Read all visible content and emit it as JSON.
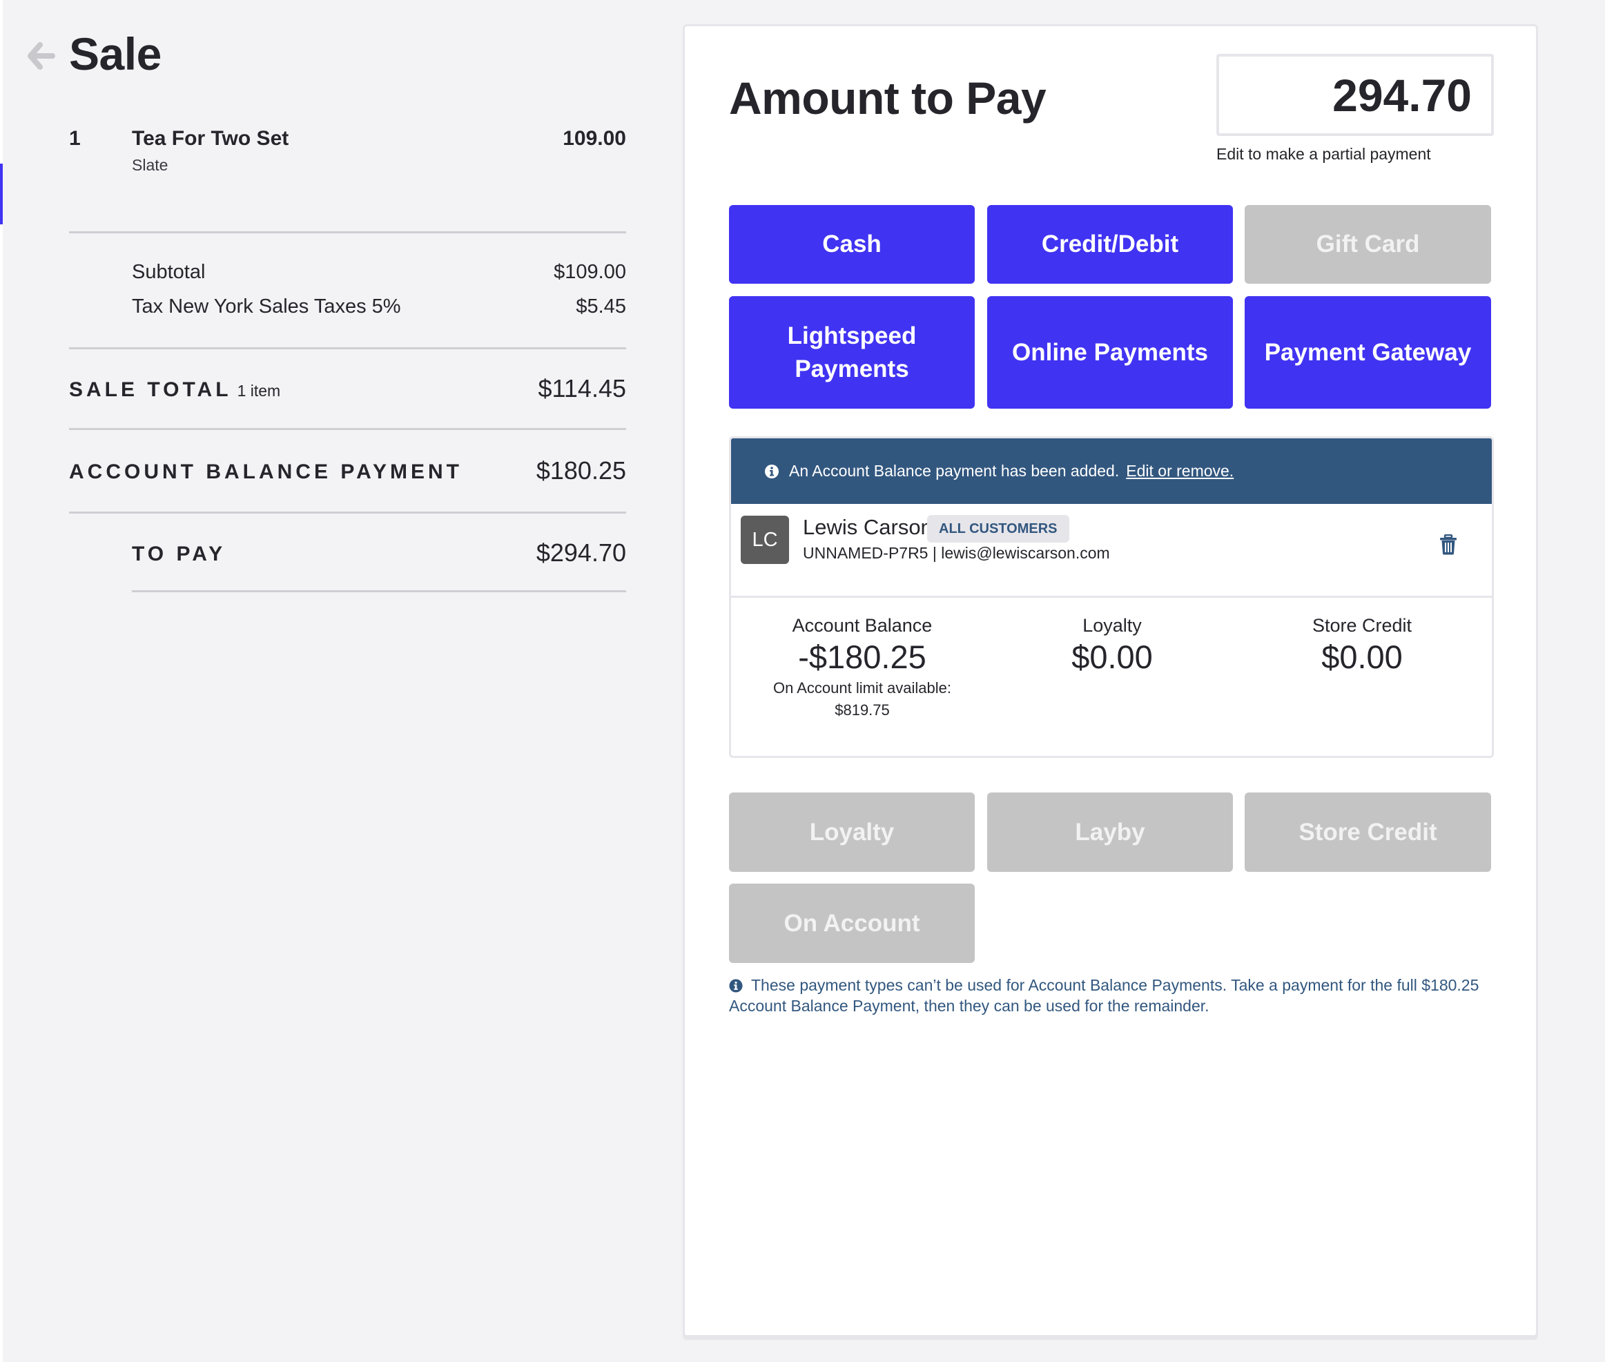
{
  "page": {
    "title": "Sale",
    "back_icon": "arrow-left-icon"
  },
  "sale": {
    "items": [
      {
        "qty": "1",
        "name": "Tea For Two Set",
        "variant": "Slate",
        "price": "109.00"
      }
    ],
    "subtotal_label": "Subtotal",
    "subtotal_value": "$109.00",
    "tax_label": "Tax New York Sales Taxes 5%",
    "tax_value": "$5.45",
    "sale_total_label": "SALE TOTAL",
    "sale_total_count": "1 item",
    "sale_total_value": "$114.45",
    "account_balance_payment_label": "ACCOUNT BALANCE PAYMENT",
    "account_balance_payment_value": "$180.25",
    "to_pay_label": "TO PAY",
    "to_pay_value": "$294.70"
  },
  "payment": {
    "title": "Amount to Pay",
    "amount_value": "294.70",
    "amount_caption": "Edit to make a partial payment",
    "methods": [
      {
        "label": "Cash",
        "enabled": true
      },
      {
        "label": "Credit/Debit",
        "enabled": true
      },
      {
        "label": "Gift Card",
        "enabled": false
      },
      {
        "label": "Lightspeed Payments",
        "enabled": true
      },
      {
        "label": "Online Payments",
        "enabled": true
      },
      {
        "label": "Payment Gateway",
        "enabled": true
      }
    ],
    "restricted_methods": [
      {
        "label": "Loyalty",
        "enabled": false
      },
      {
        "label": "Layby",
        "enabled": false
      },
      {
        "label": "Store Credit",
        "enabled": false
      },
      {
        "label": "On Account",
        "enabled": false
      }
    ],
    "restriction_note": "These payment types can’t be used for Account Balance Payments. Take a payment for the full $180.25 Account Balance Payment, then they can be used for the remainder."
  },
  "account_notice": {
    "text": "An Account Balance payment has been added.",
    "link": "Edit or remove."
  },
  "customer": {
    "initials": "LC",
    "name": "Lewis Carson",
    "group": "ALL CUSTOMERS",
    "code": "UNNAMED-P7R5",
    "email": "lewis@lewiscarson.com",
    "meta": "UNNAMED-P7R5 | lewis@lewiscarson.com",
    "stats": [
      {
        "label": "Account Balance",
        "value": "-$180.25",
        "note_line1": "On Account limit available:",
        "note_line2": "$819.75"
      },
      {
        "label": "Loyalty",
        "value": "$0.00"
      },
      {
        "label": "Store Credit",
        "value": "$0.00"
      }
    ]
  },
  "colors": {
    "accent": "#4133f2",
    "disabled": "#c4c4c4",
    "notice": "#32577f",
    "background": "#f3f2f5",
    "text": "#26252b"
  }
}
